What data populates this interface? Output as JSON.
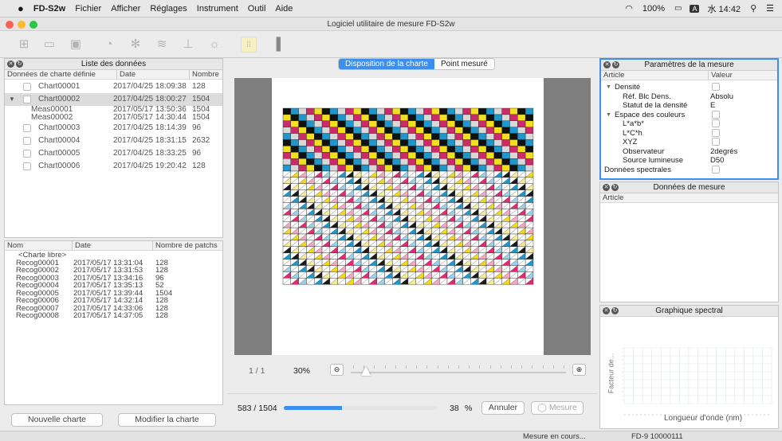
{
  "menubar": {
    "app_name": "FD-S2w",
    "menus": [
      "Fichier",
      "Afficher",
      "Réglages",
      "Instrument",
      "Outil",
      "Aide"
    ],
    "battery": "100%",
    "input_indicator": "A",
    "clock": "水 14:42"
  },
  "window": {
    "title": "Logiciel utilitaire de mesure FD-S2w"
  },
  "toolbar": {
    "icons": [
      "new-chart-icon",
      "open-icon",
      "save-icon",
      "measure-icon",
      "settings-icon",
      "print-icon",
      "layout-icon",
      "illumination-icon",
      "grid-icon",
      "panel-icon"
    ]
  },
  "data_list": {
    "title": "Liste des données",
    "columns": [
      "Données de charte définie",
      "Date",
      "Nombre"
    ],
    "rows": [
      {
        "name": "Chart00001",
        "date": "2017/04/25 18:09:38",
        "count": "128"
      },
      {
        "name": "Chart00002",
        "date": "2017/04/25 18:00:27",
        "count": "1504",
        "expanded": true,
        "selected": true
      },
      {
        "name": "Meas00001",
        "date": "2017/05/17 13:50:36",
        "count": "1504",
        "child": true
      },
      {
        "name": "Meas00002",
        "date": "2017/05/17 14:30:44",
        "count": "1504",
        "child": true
      },
      {
        "name": "Chart00003",
        "date": "2017/04/25 18:14:39",
        "count": "96"
      },
      {
        "name": "Chart00004",
        "date": "2017/04/25 18:31:15",
        "count": "2632"
      },
      {
        "name": "Chart00005",
        "date": "2017/04/25 18:33:25",
        "count": "96"
      },
      {
        "name": "Chart00006",
        "date": "2017/04/25 19:20:42",
        "count": "128"
      }
    ]
  },
  "recog_list": {
    "columns": [
      "Nom",
      "Date",
      "Nombre de patchs"
    ],
    "rows": [
      {
        "name": "<Charte libre>",
        "date": "",
        "count": ""
      },
      {
        "name": "Recog00001",
        "date": "2017/05/17 13:31:04",
        "count": "128"
      },
      {
        "name": "Recog00002",
        "date": "2017/05/17 13:31:53",
        "count": "128"
      },
      {
        "name": "Recog00003",
        "date": "2017/05/17 13:34:16",
        "count": "96"
      },
      {
        "name": "Recog00004",
        "date": "2017/05/17 13:35:13",
        "count": "52"
      },
      {
        "name": "Recog00005",
        "date": "2017/05/17 13:39:44",
        "count": "1504"
      },
      {
        "name": "Recog00006",
        "date": "2017/05/17 14:32:14",
        "count": "128"
      },
      {
        "name": "Recog00007",
        "date": "2017/05/17 14:33:06",
        "count": "128"
      },
      {
        "name": "Recog00008",
        "date": "2017/05/17 14:37:05",
        "count": "128"
      }
    ]
  },
  "left_buttons": {
    "new_chart": "Nouvelle charte",
    "edit_chart": "Modifier la charte"
  },
  "tabs": {
    "layout": "Disposition de la charte",
    "point": "Point mesuré"
  },
  "preview": {
    "page_label": "1 / 1",
    "zoom": "30%",
    "zoom_level": 0.05,
    "progress_text": "583 / 1504",
    "progress_fraction": 0.38,
    "percent": "38",
    "percent_unit": "%",
    "cancel": "Annuler",
    "measure": "Mesure"
  },
  "params": {
    "title": "Paramètres de la mesure",
    "col_article": "Article",
    "col_value": "Valeur",
    "rows": [
      {
        "label": "Densité",
        "indent": 0,
        "toggle": "▼",
        "checked": true
      },
      {
        "label": "Réf. Blc Dens.",
        "indent": 2,
        "value": "Absolu"
      },
      {
        "label": "Statut de la densité",
        "indent": 2,
        "value": "E"
      },
      {
        "label": "Espace des couleurs",
        "indent": 0,
        "toggle": "▼",
        "checked": true
      },
      {
        "label": "L*a*b*",
        "indent": 2,
        "checked": true
      },
      {
        "label": "L*C*h",
        "indent": 2,
        "checked": false
      },
      {
        "label": "XYZ",
        "indent": 2,
        "checked": false
      },
      {
        "label": "Observateur",
        "indent": 2,
        "value": "2degrés"
      },
      {
        "label": "Source lumineuse",
        "indent": 2,
        "value": "D50"
      },
      {
        "label": "Données spectrales",
        "indent": 0,
        "checked": true
      }
    ]
  },
  "meas_data": {
    "title": "Données de mesure",
    "col_article": "Article"
  },
  "spectral": {
    "title": "Graphique spectral",
    "ylabel": "Facteur de...",
    "xlabel": "Longueur d'onde (nm)"
  },
  "status": {
    "left": "Mesure en cours...",
    "right": "FD-9 10000111"
  },
  "colors": {
    "accent": "#3b8ff0",
    "selected_row": "#dcdcdc"
  }
}
